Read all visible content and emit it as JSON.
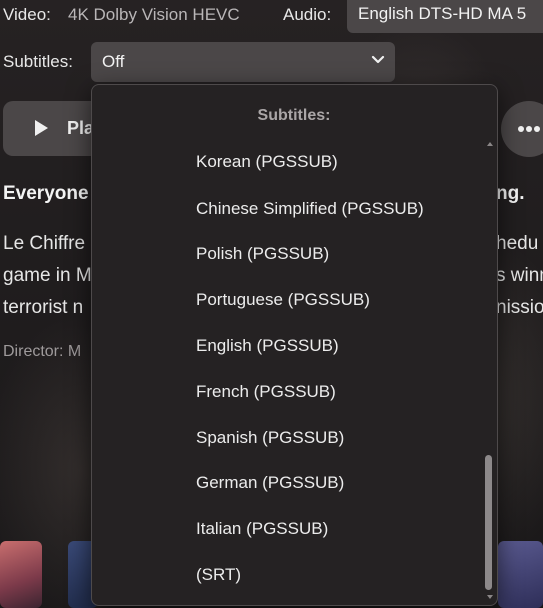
{
  "media": {
    "video_label": "Video:",
    "video_value": "4K Dolby Vision HEVC",
    "audio_label": "Audio:",
    "audio_value": "English DTS-HD MA 5",
    "subtitles_label": "Subtitles:",
    "subtitles_value": "Off"
  },
  "actions": {
    "play_label": "Pla",
    "more_icon": "more-horizontal-icon"
  },
  "overview": {
    "tagline_left": "Everyone",
    "tagline_right": "ng.",
    "line1_left": "Le Chiffre",
    "line1_right": "hedu",
    "line2_left": "game in M",
    "line2_right": "s winn",
    "line3_left": "terrorist n",
    "line3_right": "nissio",
    "director": "Director: M"
  },
  "subtitles_dropdown": {
    "header": "Subtitles:",
    "options": [
      "Korean (PGSSUB)",
      "Chinese Simplified (PGSSUB)",
      "Polish (PGSSUB)",
      "Portuguese (PGSSUB)",
      "English (PGSSUB)",
      "French (PGSSUB)",
      "Spanish (PGSSUB)",
      "German (PGSSUB)",
      "Italian (PGSSUB)",
      "(SRT)"
    ]
  },
  "colors": {
    "background": "#1d1b1c",
    "control": "#4b4748",
    "dropdown": "#252223"
  }
}
